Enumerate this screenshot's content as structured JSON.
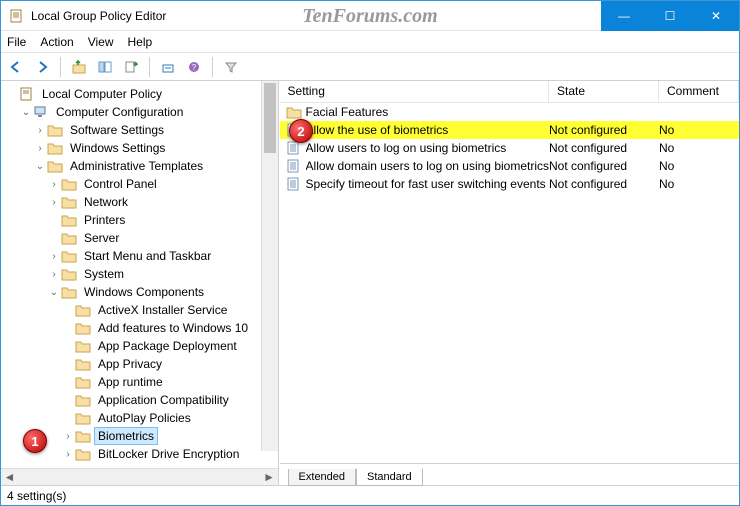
{
  "window": {
    "title": "Local Group Policy Editor",
    "watermark": "TenForums.com"
  },
  "winbtns": {
    "min": "—",
    "max": "☐",
    "close": "✕"
  },
  "menu": {
    "file": "File",
    "action": "Action",
    "view": "View",
    "help": "Help"
  },
  "tree": {
    "root": "Local Computer Policy",
    "cc": "Computer Configuration",
    "ss": "Software Settings",
    "ws": "Windows Settings",
    "at": "Administrative Templates",
    "cp": "Control Panel",
    "nw": "Network",
    "pr": "Printers",
    "sv": "Server",
    "smt": "Start Menu and Taskbar",
    "sys": "System",
    "wc": "Windows Components",
    "ax": "ActiveX Installer Service",
    "afw": "Add features to Windows 10",
    "apd": "App Package Deployment",
    "apv": "App Privacy",
    "art": "App runtime",
    "ac": "Application Compatibility",
    "apl": "AutoPlay Policies",
    "bio": "Biometrics",
    "bde": "BitLocker Drive Encryption"
  },
  "columns": {
    "setting": "Setting",
    "state": "State",
    "comment": "Comment"
  },
  "rows": [
    {
      "type": "folder",
      "setting": "Facial Features",
      "state": "",
      "comment": ""
    },
    {
      "type": "policy",
      "setting": "Allow the use of biometrics",
      "state": "Not configured",
      "comment": "No",
      "highlight": true
    },
    {
      "type": "policy",
      "setting": "Allow users to log on using biometrics",
      "state": "Not configured",
      "comment": "No"
    },
    {
      "type": "policy",
      "setting": "Allow domain users to log on using biometrics",
      "state": "Not configured",
      "comment": "No"
    },
    {
      "type": "policy",
      "setting": "Specify timeout for fast user switching events",
      "state": "Not configured",
      "comment": "No"
    }
  ],
  "tabs": {
    "extended": "Extended",
    "standard": "Standard"
  },
  "status": {
    "text": "4 setting(s)"
  },
  "callouts": {
    "one": "1",
    "two": "2"
  }
}
